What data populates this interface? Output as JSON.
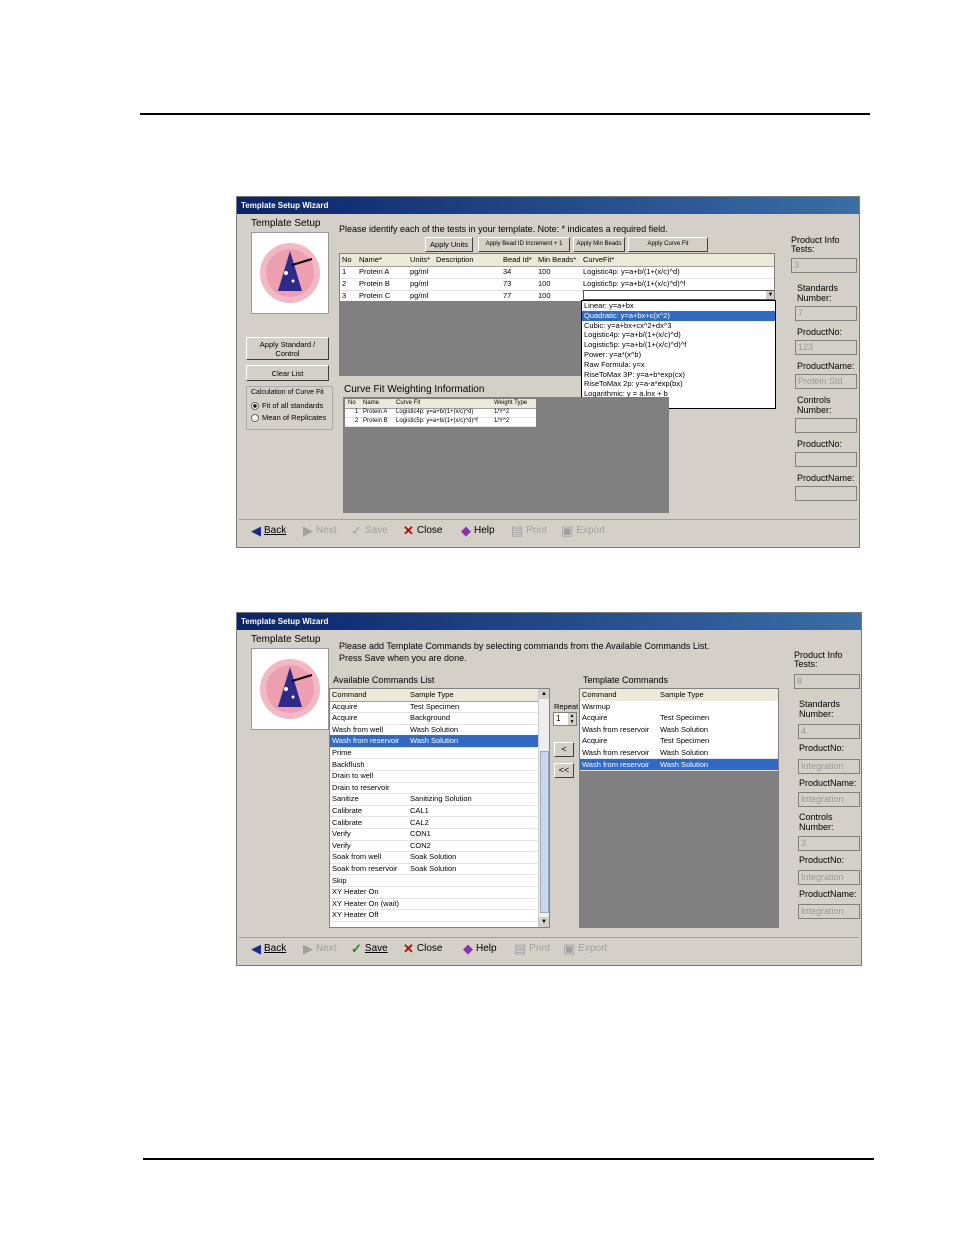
{
  "window1": {
    "title": "Template Setup Wizard",
    "heading": "Template Setup",
    "instruction": "Please identify each of the tests in your template.  Note: * indicates a required field.",
    "top_buttons": [
      "Apply Units",
      "Apply Bead ID Increment + 1",
      "Apply Min Beads",
      "Apply Curve Fit"
    ],
    "side_buttons": {
      "apply": "Apply Standard / Control",
      "clear": "Clear List"
    },
    "calc": {
      "label": "Calculation of Curve Fit",
      "opt1": "Fit of all standards",
      "opt2": "Mean of Replicates"
    },
    "tests_table": {
      "headers": [
        "No",
        "Name*",
        "Units*",
        "Description",
        "Bead Id*",
        "Min Beads*",
        "CurveFit*"
      ],
      "rows": [
        [
          "1",
          "Protein A",
          "pg/ml",
          "",
          "34",
          "100",
          "Logistic4p: y=a+b/(1+(x/c)^d)"
        ],
        [
          "2",
          "Protein B",
          "pg/ml",
          "",
          "73",
          "100",
          "Logistic5p: y=a+b/(1+(x/c)^d)^f"
        ],
        [
          "3",
          "Protein C",
          "pg/ml",
          "",
          "77",
          "100",
          ""
        ]
      ]
    },
    "curve_options": [
      "Linear: y=a+bx",
      "Quadratic: y=a+bx+c(x^2)",
      "Cubic: y=a+bx+cx^2+dx^3",
      "Logistic4p: y=a+b/(1+(x/c)^d)",
      "Logistic5p: y=a+b/(1+(x/c)^d)^f",
      "Power: y=a*(x^b)",
      "Raw Formula: y=x",
      "RiseToMax 3P: y=a+b*exp(cx)",
      "RiseToMax 2p: y=a-a*exp(bx)",
      "Logarithmic: y = a.lnx + b",
      "Exponential: y = a.e^xb"
    ],
    "curve_selected_index": 1,
    "weighting": {
      "label": "Curve Fit Weighting Information",
      "headers": [
        "No",
        "Name",
        "Curve Fit",
        "Weight Type"
      ],
      "rows": [
        [
          "1",
          "Protein A",
          "Logistic4p: y=a+b/(1+(x/c)^d)",
          "1/Y^2"
        ],
        [
          "2",
          "Protein B",
          "Logistic5p: y=a+b/(1+(x/c)^d)^f",
          "1/Y^2"
        ]
      ]
    },
    "product_info": {
      "label": "Product Info",
      "tests_label": "Tests:",
      "tests_value": "3",
      "standards_label": "Standards Number:",
      "standards_value": "7",
      "productno_label": "ProductNo:",
      "productno_value": "123",
      "productname_label": "ProductName:",
      "productname_value": "Protein Std",
      "controls_label": "Controls Number:",
      "controls_value": "",
      "productno2_label": "ProductNo:",
      "productno2_value": "",
      "productname2_label": "ProductName:",
      "productname2_value": ""
    },
    "nav": {
      "back": "Back",
      "next": "Next",
      "save": "Save",
      "close": "Close",
      "help": "Help",
      "print": "Print",
      "export": "Export"
    }
  },
  "window2": {
    "title": "Template Setup Wizard",
    "heading": "Template Setup",
    "instruction1": "Please add Template Commands by selecting commands from the Available Commands List.",
    "instruction2": "Press Save when you are done.",
    "available_label": "Available Commands List",
    "available_headers": [
      "Command",
      "Sample Type"
    ],
    "available_rows": [
      [
        "Acquire",
        "Test Specimen"
      ],
      [
        "Acquire",
        "Background"
      ],
      [
        "Wash from well",
        "Wash Solution"
      ],
      [
        "Wash from reservoir",
        "Wash Solution"
      ],
      [
        "Prime",
        ""
      ],
      [
        "Backflush",
        ""
      ],
      [
        "Drain to well",
        ""
      ],
      [
        "Drain to reservoir",
        ""
      ],
      [
        "Sanitize",
        "Sanitizing Solution"
      ],
      [
        "Calibrate",
        "CAL1"
      ],
      [
        "Calibrate",
        "CAL2"
      ],
      [
        "Verify",
        "CON1"
      ],
      [
        "Verify",
        "CON2"
      ],
      [
        "Soak from well",
        "Soak Solution"
      ],
      [
        "Soak from reservoir",
        "Soak Solution"
      ],
      [
        "Skip",
        ""
      ],
      [
        "XY Heater On",
        ""
      ],
      [
        "XY Heater On (wait)",
        ""
      ],
      [
        "XY Heater Off",
        ""
      ]
    ],
    "available_selected": 3,
    "repeat_label": "Repeat",
    "repeat_value": "1",
    "move_buttons": [
      "<",
      "<<"
    ],
    "template_label": "Template Commands",
    "template_headers": [
      "Command",
      "Sample Type"
    ],
    "template_rows": [
      [
        "Warmup",
        ""
      ],
      [
        "Acquire",
        "Test Specimen"
      ],
      [
        "Wash from reservoir",
        "Wash Solution"
      ],
      [
        "Acquire",
        "Test Specimen"
      ],
      [
        "Wash from reservoir",
        "Wash Solution"
      ],
      [
        "Wash from reservoir",
        "Wash Solution"
      ]
    ],
    "template_selected": 5,
    "product_info": {
      "label": "Product Info",
      "tests_label": "Tests:",
      "tests_value": "8",
      "standards_label": "Standards Number:",
      "standards_value": "4",
      "productno_label": "ProductNo:",
      "productno_value": "Integration",
      "productname_label": "ProductName:",
      "productname_value": "Integration",
      "controls_label": "Controls Number:",
      "controls_value": "3",
      "productno2_label": "ProductNo:",
      "productno2_value": "Integration",
      "productname2_label": "ProductName:",
      "productname2_value": "Integration"
    },
    "nav": {
      "back": "Back",
      "next": "Next",
      "save": "Save",
      "close": "Close",
      "help": "Help",
      "print": "Print",
      "export": "Export"
    }
  },
  "colors": {
    "title_bar": "#0a246a",
    "window_bg": "#d4d0c8",
    "selection": "#316ac5",
    "panel_gray": "#808080"
  }
}
